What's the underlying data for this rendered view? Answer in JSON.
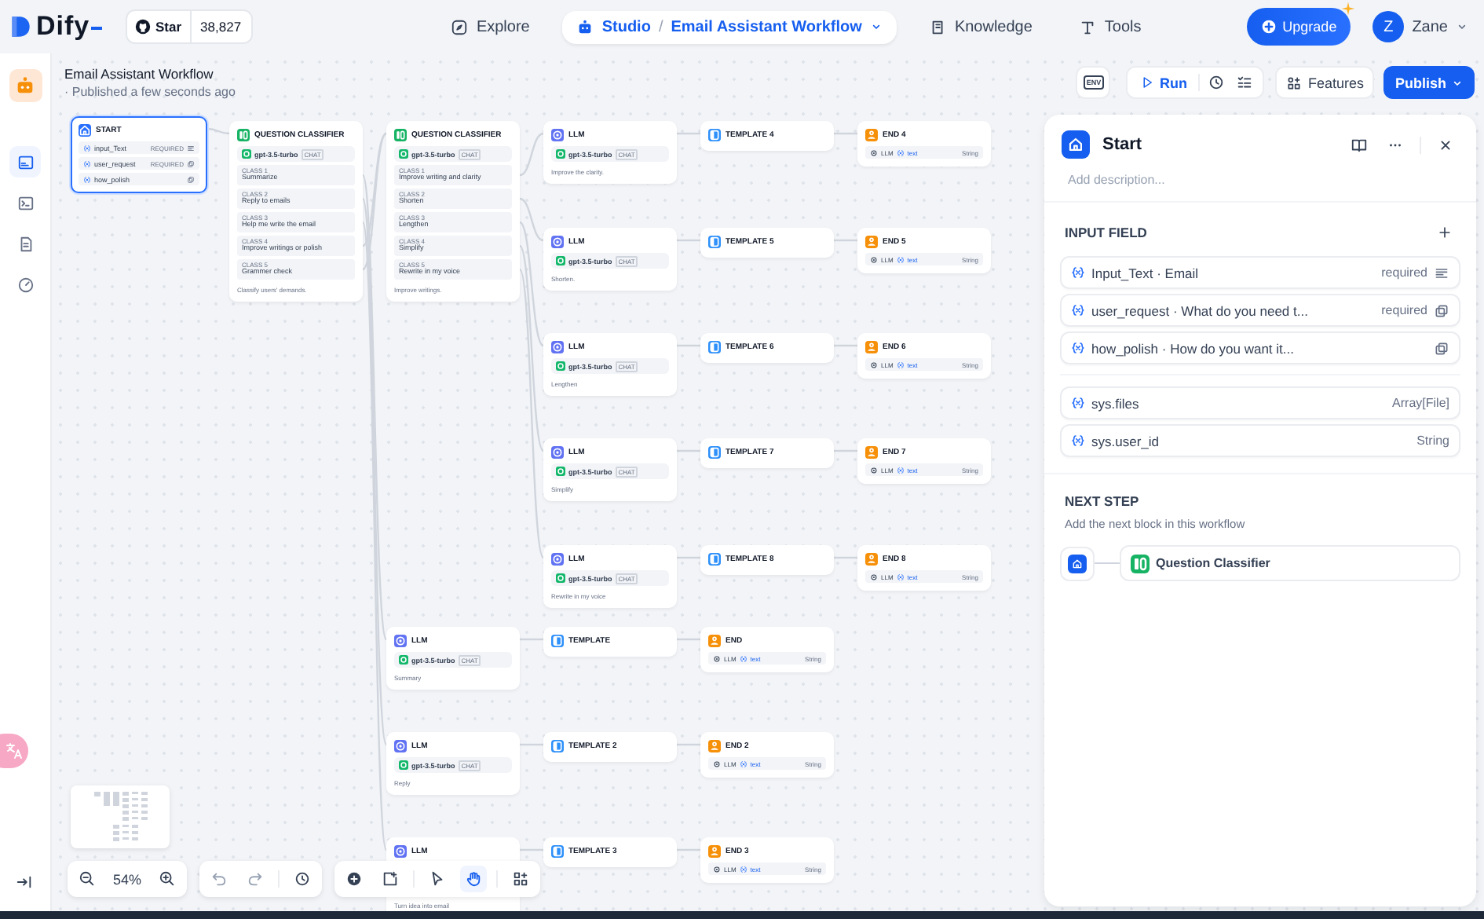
{
  "header": {
    "logo": "Dify",
    "github": {
      "label": "Star",
      "count": "38,827"
    },
    "nav": [
      {
        "label": "Explore",
        "selected": false
      },
      {
        "label": "Studio",
        "selected": true,
        "separator": "/",
        "app": "Email Assistant Workflow"
      },
      {
        "label": "Knowledge",
        "selected": false
      },
      {
        "label": "Tools",
        "selected": false
      }
    ],
    "upgrade": "Upgrade",
    "user": {
      "initial": "Z",
      "name": "Zane"
    }
  },
  "sidebar": {
    "items": [
      {
        "selected": true
      },
      {
        "selected": false
      },
      {
        "selected": false
      },
      {
        "selected": false
      }
    ]
  },
  "app": {
    "title": "Email Assistant Workflow",
    "status": "· Published a few seconds ago"
  },
  "toolbar": {
    "env": "ENV",
    "run": "Run",
    "features": "Features",
    "publish": "Publish"
  },
  "canvas": {
    "start": {
      "title": "START",
      "selected": true,
      "variables": [
        {
          "name": "input_Text",
          "badge": "REQUIRED",
          "kind": "paragraph"
        },
        {
          "name": "user_request",
          "badge": "REQUIRED",
          "kind": "select"
        },
        {
          "name": "how_polish",
          "kind": "select"
        }
      ]
    },
    "classifiers": [
      {
        "title": "QUESTION CLASSIFIER",
        "model": "gpt-3.5-turbo",
        "mode": "CHAT",
        "description": "Classify users' demands.",
        "classes": [
          {
            "label": "CLASS 1",
            "text": "Summarize"
          },
          {
            "label": "CLASS 2",
            "text": "Reply to emails"
          },
          {
            "label": "CLASS 3",
            "text": "Help me write the email"
          },
          {
            "label": "CLASS 4",
            "text": "Improve writings or polish"
          },
          {
            "label": "CLASS 5",
            "text": "Grammer check"
          }
        ]
      },
      {
        "title": "QUESTION CLASSIFIER",
        "model": "gpt-3.5-turbo",
        "mode": "CHAT",
        "description": "Improve writings.",
        "classes": [
          {
            "label": "CLASS 1",
            "text": "Improve writing and clarity"
          },
          {
            "label": "CLASS 2",
            "text": "Shorten"
          },
          {
            "label": "CLASS 3",
            "text": "Lengthen"
          },
          {
            "label": "CLASS 4",
            "text": "Simplify"
          },
          {
            "label": "CLASS 5",
            "text": "Rewrite in my voice"
          }
        ]
      }
    ],
    "chains": [
      {
        "llm": {
          "title": "LLM",
          "model": "gpt-3.5-turbo",
          "mode": "CHAT",
          "description": "Improve the clarity."
        },
        "template": {
          "title": "TEMPLATE 4"
        },
        "end": {
          "title": "END 4",
          "source": "LLM",
          "variable": "text",
          "type": "String"
        }
      },
      {
        "llm": {
          "title": "LLM",
          "model": "gpt-3.5-turbo",
          "mode": "CHAT",
          "description": "Shorten."
        },
        "template": {
          "title": "TEMPLATE 5"
        },
        "end": {
          "title": "END 5",
          "source": "LLM",
          "variable": "text",
          "type": "String"
        }
      },
      {
        "llm": {
          "title": "LLM",
          "model": "gpt-3.5-turbo",
          "mode": "CHAT",
          "description": "Lengthen"
        },
        "template": {
          "title": "TEMPLATE 6"
        },
        "end": {
          "title": "END 6",
          "source": "LLM",
          "variable": "text",
          "type": "String"
        }
      },
      {
        "llm": {
          "title": "LLM",
          "model": "gpt-3.5-turbo",
          "mode": "CHAT",
          "description": "Simplify"
        },
        "template": {
          "title": "TEMPLATE 7"
        },
        "end": {
          "title": "END 7",
          "source": "LLM",
          "variable": "text",
          "type": "String"
        }
      },
      {
        "llm": {
          "title": "LLM",
          "model": "gpt-3.5-turbo",
          "mode": "CHAT",
          "description": "Rewrite in my voice"
        },
        "template": {
          "title": "TEMPLATE 8"
        },
        "end": {
          "title": "END 8",
          "source": "LLM",
          "variable": "text",
          "type": "String"
        }
      },
      {
        "llm": {
          "title": "LLM",
          "model": "gpt-3.5-turbo",
          "mode": "CHAT",
          "description": "Summary"
        },
        "template": {
          "title": "TEMPLATE"
        },
        "end": {
          "title": "END",
          "source": "LLM",
          "variable": "text",
          "type": "String"
        }
      },
      {
        "llm": {
          "title": "LLM",
          "model": "gpt-3.5-turbo",
          "mode": "CHAT",
          "description": "Reply"
        },
        "template": {
          "title": "TEMPLATE 2"
        },
        "end": {
          "title": "END 2",
          "source": "LLM",
          "variable": "text",
          "type": "String"
        }
      },
      {
        "llm": {
          "title": "LLM",
          "description": "Turn idea into email"
        },
        "template": {
          "title": "TEMPLATE 3"
        },
        "end": {
          "title": "END 3",
          "source": "LLM",
          "variable": "text",
          "type": "String"
        }
      }
    ]
  },
  "controls": {
    "zoom": "54%",
    "tools": [
      {
        "selected": false
      },
      {
        "selected": true
      }
    ]
  },
  "panel": {
    "title": "Start",
    "description_placeholder": "Add description...",
    "input_heading": "INPUT FIELD",
    "inputs": [
      {
        "text": "Input_Text · Email",
        "badge": "required",
        "kind": "paragraph"
      },
      {
        "text": "user_request · What do you need t...",
        "badge": "required",
        "kind": "select"
      },
      {
        "text": "how_polish · How do you want it...",
        "kind": "select"
      }
    ],
    "system": [
      {
        "name": "sys.files",
        "type": "Array[File]"
      },
      {
        "name": "sys.user_id",
        "type": "String"
      }
    ],
    "next_heading": "NEXT STEP",
    "next_hint": "Add the next block in this workflow",
    "next_block": "Question Classifier"
  }
}
